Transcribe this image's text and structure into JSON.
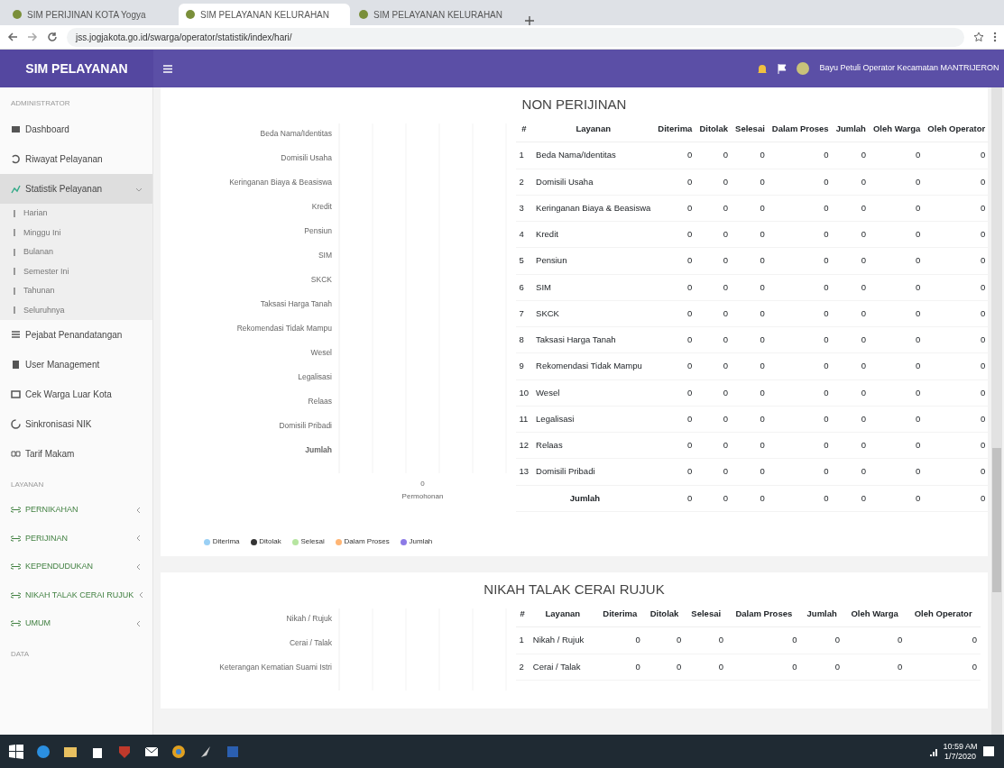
{
  "browser": {
    "tabs": [
      {
        "title": "SIM PERIJINAN KOTA Yogya",
        "selected": false
      },
      {
        "title": "SIM PELAYANAN KELURAHAN",
        "selected": true
      },
      {
        "title": "SIM PELAYANAN KELURAHAN",
        "selected": false
      }
    ],
    "url": "jss.jogjakota.go.id/swarga/operator/statistik/index/hari/"
  },
  "navbar": {
    "brand": "SIM PELAYANAN",
    "user": "Bayu Petuli Operator Kecamatan MANTRIJERON"
  },
  "sidebar": {
    "sections": [
      {
        "heading": "ADMINISTRATOR",
        "items": [
          {
            "label": "Dashboard",
            "selected": false
          },
          {
            "label": "Riwayat Pelayanan",
            "selected": false
          },
          {
            "label": "Statistik Pelayanan",
            "selected": true,
            "expanded": true,
            "children": [
              {
                "label": "Harian",
                "selected": false
              },
              {
                "label": "Minggu Ini",
                "selected": false
              },
              {
                "label": "Bulanan",
                "selected": false
              },
              {
                "label": "Semester Ini",
                "selected": false
              },
              {
                "label": "Tahunan",
                "selected": false
              },
              {
                "label": "Seluruhnya",
                "selected": false
              }
            ]
          },
          {
            "label": "Pejabat Penandatangan",
            "selected": false
          },
          {
            "label": "User Management",
            "selected": false
          },
          {
            "label": "Cek Warga Luar Kota",
            "selected": false
          },
          {
            "label": "Sinkronisasi NIK",
            "selected": false
          },
          {
            "label": "Tarif Makam",
            "selected": false
          }
        ]
      },
      {
        "heading": "LAYANAN",
        "items": [
          {
            "label": "PERNIKAHAN",
            "selected": false,
            "expanded": false
          },
          {
            "label": "PERIJINAN",
            "selected": false,
            "expanded": false
          },
          {
            "label": "KEPENDUDUKAN",
            "selected": false,
            "expanded": false
          },
          {
            "label": "NIKAH TALAK CERAI RUJUK",
            "selected": false,
            "expanded": false
          },
          {
            "label": "UMUM",
            "selected": false,
            "expanded": false
          }
        ]
      },
      {
        "heading": "DATA"
      }
    ]
  },
  "sections": [
    {
      "title": "NON PERIJINAN",
      "chart": {
        "categories": [
          "Beda Nama/Identitas",
          "Domisili Usaha",
          "Keringanan Biaya & Beasiswa",
          "Kredit",
          "Pensiun",
          "SIM",
          "SKCK",
          "Taksasi Harga Tanah",
          "Rekomendasi Tidak Mampu",
          "Wesel",
          "Legalisasi",
          "Relaas",
          "Domisili Pribadi",
          "Jumlah"
        ],
        "tick": "0",
        "axis_title": "Permohonan",
        "legend": [
          {
            "name": "Diterima",
            "color": "#9ad0f5"
          },
          {
            "name": "Ditolak",
            "color": "#333333"
          },
          {
            "name": "Selesai",
            "color": "#b6e5a0"
          },
          {
            "name": "Dalam Proses",
            "color": "#ffb574"
          },
          {
            "name": "Jumlah",
            "color": "#8c7ae6"
          }
        ]
      },
      "table": {
        "columns": [
          "#",
          "Layanan",
          "Diterima",
          "Ditolak",
          "Selesai",
          "Dalam Proses",
          "Jumlah",
          "Oleh Warga",
          "Oleh Operator"
        ],
        "rows": [
          {
            "no": "1",
            "service": "Beda Nama/Identitas",
            "values": [
              "0",
              "0",
              "0",
              "0",
              "0",
              "0",
              "0"
            ]
          },
          {
            "no": "2",
            "service": "Domisili Usaha",
            "values": [
              "0",
              "0",
              "0",
              "0",
              "0",
              "0",
              "0"
            ]
          },
          {
            "no": "3",
            "service": "Keringanan Biaya & Beasiswa",
            "values": [
              "0",
              "0",
              "0",
              "0",
              "0",
              "0",
              "0"
            ]
          },
          {
            "no": "4",
            "service": "Kredit",
            "values": [
              "0",
              "0",
              "0",
              "0",
              "0",
              "0",
              "0"
            ]
          },
          {
            "no": "5",
            "service": "Pensiun",
            "values": [
              "0",
              "0",
              "0",
              "0",
              "0",
              "0",
              "0"
            ]
          },
          {
            "no": "6",
            "service": "SIM",
            "values": [
              "0",
              "0",
              "0",
              "0",
              "0",
              "0",
              "0"
            ]
          },
          {
            "no": "7",
            "service": "SKCK",
            "values": [
              "0",
              "0",
              "0",
              "0",
              "0",
              "0",
              "0"
            ]
          },
          {
            "no": "8",
            "service": "Taksasi Harga Tanah",
            "values": [
              "0",
              "0",
              "0",
              "0",
              "0",
              "0",
              "0"
            ]
          },
          {
            "no": "9",
            "service": "Rekomendasi Tidak Mampu",
            "values": [
              "0",
              "0",
              "0",
              "0",
              "0",
              "0",
              "0"
            ]
          },
          {
            "no": "10",
            "service": "Wesel",
            "values": [
              "0",
              "0",
              "0",
              "0",
              "0",
              "0",
              "0"
            ]
          },
          {
            "no": "11",
            "service": "Legalisasi",
            "values": [
              "0",
              "0",
              "0",
              "0",
              "0",
              "0",
              "0"
            ]
          },
          {
            "no": "12",
            "service": "Relaas",
            "values": [
              "0",
              "0",
              "0",
              "0",
              "0",
              "0",
              "0"
            ]
          },
          {
            "no": "13",
            "service": "Domisili Pribadi",
            "values": [
              "0",
              "0",
              "0",
              "0",
              "0",
              "0",
              "0"
            ]
          }
        ],
        "total": {
          "label": "Jumlah",
          "values": [
            "0",
            "0",
            "0",
            "0",
            "0",
            "0",
            "0"
          ]
        }
      }
    },
    {
      "title": "NIKAH TALAK CERAI RUJUK",
      "chart": {
        "categories": [
          "Nikah / Rujuk",
          "Cerai / Talak",
          "Keterangan Kematian Suami Istri"
        ]
      },
      "table": {
        "columns": [
          "#",
          "Layanan",
          "Diterima",
          "Ditolak",
          "Selesai",
          "Dalam Proses",
          "Jumlah",
          "Oleh Warga",
          "Oleh Operator"
        ],
        "rows": [
          {
            "no": "1",
            "service": "Nikah / Rujuk",
            "values": [
              "0",
              "0",
              "0",
              "0",
              "0",
              "0",
              "0"
            ]
          },
          {
            "no": "2",
            "service": "Cerai / Talak",
            "values": [
              "0",
              "0",
              "0",
              "0",
              "0",
              "0",
              "0"
            ]
          }
        ]
      }
    }
  ],
  "taskbar": {
    "time": "10:59 AM",
    "date": "1/7/2020"
  }
}
